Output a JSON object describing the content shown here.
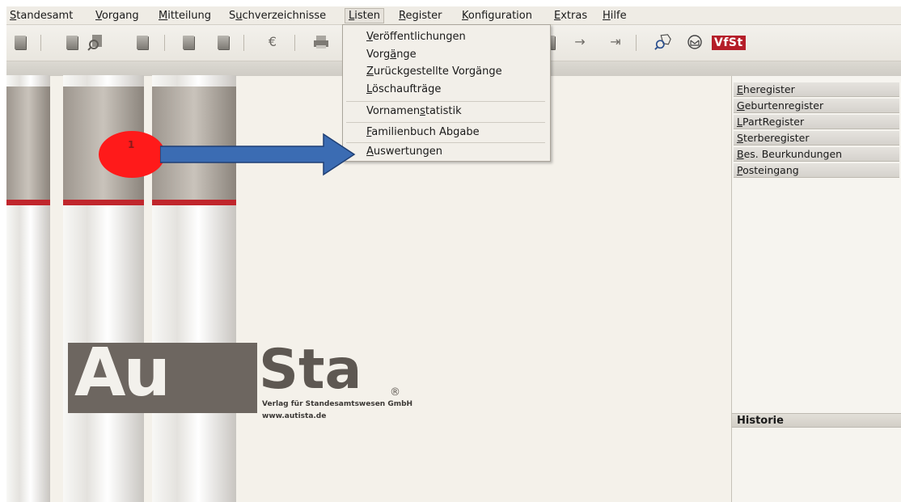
{
  "menubar": {
    "items": [
      {
        "pre": "",
        "u": "S",
        "post": "tandesamt"
      },
      {
        "pre": "",
        "u": "V",
        "post": "organg"
      },
      {
        "pre": "",
        "u": "M",
        "post": "itteilung"
      },
      {
        "pre": "S",
        "u": "u",
        "post": "chverzeichnisse"
      },
      {
        "pre": "",
        "u": "L",
        "post": "isten"
      },
      {
        "pre": "",
        "u": "R",
        "post": "egister"
      },
      {
        "pre": "",
        "u": "K",
        "post": "onfiguration"
      },
      {
        "pre": "",
        "u": "E",
        "post": "xtras"
      },
      {
        "pre": "",
        "u": "H",
        "post": "ilfe"
      }
    ],
    "active": "Listen"
  },
  "toolbar": {
    "vfst_label": "VfSt",
    "arrow_right": "→",
    "arrow_last": "⇥",
    "euro": "€"
  },
  "dropdown": {
    "items": [
      {
        "pre": "",
        "u": "V",
        "post": "eröffentlichungen"
      },
      {
        "pre": "Vorg",
        "u": "ä",
        "post": "nge"
      },
      {
        "pre": "",
        "u": "Z",
        "post": "urückgestellte Vorgänge"
      },
      {
        "pre": "",
        "u": "L",
        "post": "öschaufträge"
      },
      {
        "pre": "Vornamen",
        "u": "s",
        "post": "tatistik"
      },
      {
        "pre": "",
        "u": "F",
        "post": "amilienbuch Abgabe"
      },
      {
        "pre": "",
        "u": "A",
        "post": "uswertungen"
      }
    ]
  },
  "registers": [
    {
      "u": "E",
      "post": "heregister"
    },
    {
      "u": "G",
      "post": "eburtenregister"
    },
    {
      "u": "L",
      "post": "PartRegister"
    },
    {
      "u": "S",
      "post": "terberegister"
    },
    {
      "u": "B",
      "post": "es. Beurkundungen"
    },
    {
      "u": "P",
      "post": "osteingang"
    }
  ],
  "historie": "Historie",
  "logo": {
    "au": "Au",
    "sta": "Sta",
    "reg": "®",
    "sub1": "Verlag für Standesamtswesen GmbH",
    "sub2": "www.autista.de"
  },
  "annotation": {
    "number": "1"
  },
  "colors": {
    "vfst": "#b51e29",
    "annotation": "#ff1a1a",
    "arrow": "#3b6cb3"
  }
}
